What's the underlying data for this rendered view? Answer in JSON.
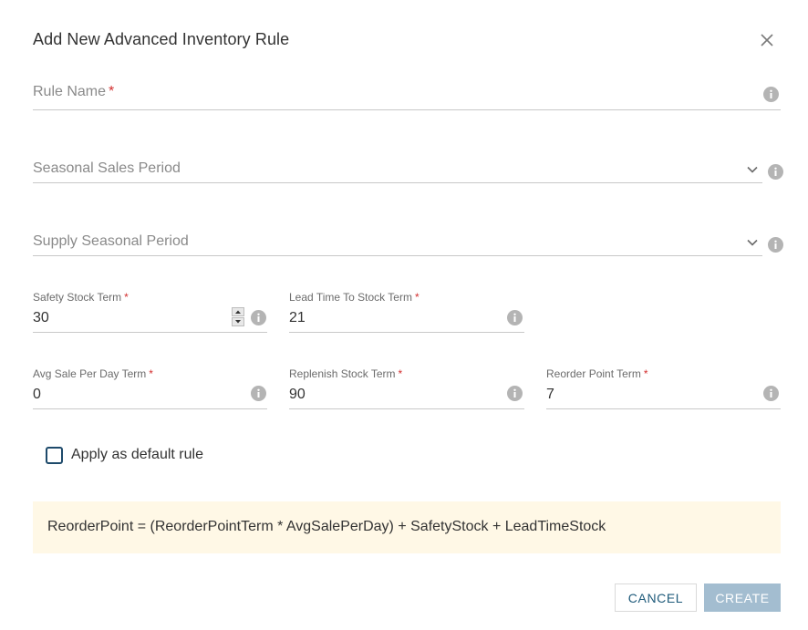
{
  "dialog": {
    "title": "Add New Advanced Inventory Rule"
  },
  "fields": {
    "rule_name": {
      "label": "Rule Name",
      "required_mark": "*"
    },
    "seasonal_sales_period": {
      "label": "Seasonal Sales Period"
    },
    "supply_seasonal_period": {
      "label": "Supply Seasonal Period"
    },
    "safety_stock_term": {
      "label": "Safety Stock Term",
      "required_mark": "*",
      "value": "30"
    },
    "lead_time_to_stock_term": {
      "label": "Lead Time To Stock Term",
      "required_mark": "*",
      "value": "21"
    },
    "avg_sale_per_day_term": {
      "label": "Avg Sale Per Day Term",
      "required_mark": "*",
      "value": "0"
    },
    "replenish_stock_term": {
      "label": "Replenish Stock Term",
      "required_mark": "*",
      "value": "90"
    },
    "reorder_point_term": {
      "label": "Reorder Point Term",
      "required_mark": "*",
      "value": "7"
    }
  },
  "default_rule": {
    "label": "Apply as default rule",
    "checked": false
  },
  "formula": "ReorderPoint = (ReorderPointTerm * AvgSalePerDay) + SafetyStock + LeadTimeStock",
  "buttons": {
    "cancel": "CANCEL",
    "create": "CREATE"
  },
  "icons": {
    "close": "close-icon",
    "info": "info-icon",
    "dropdown": "chevron-down-icon",
    "spinner_up": "arrow-up-icon",
    "spinner_down": "arrow-down-icon"
  },
  "colors": {
    "accent": "#1e4a6b",
    "required": "#d32f2f",
    "formula_bg": "#fff8e6",
    "create_button_bg": "#a3bdd0",
    "cancel_text": "#1e5a7a"
  }
}
